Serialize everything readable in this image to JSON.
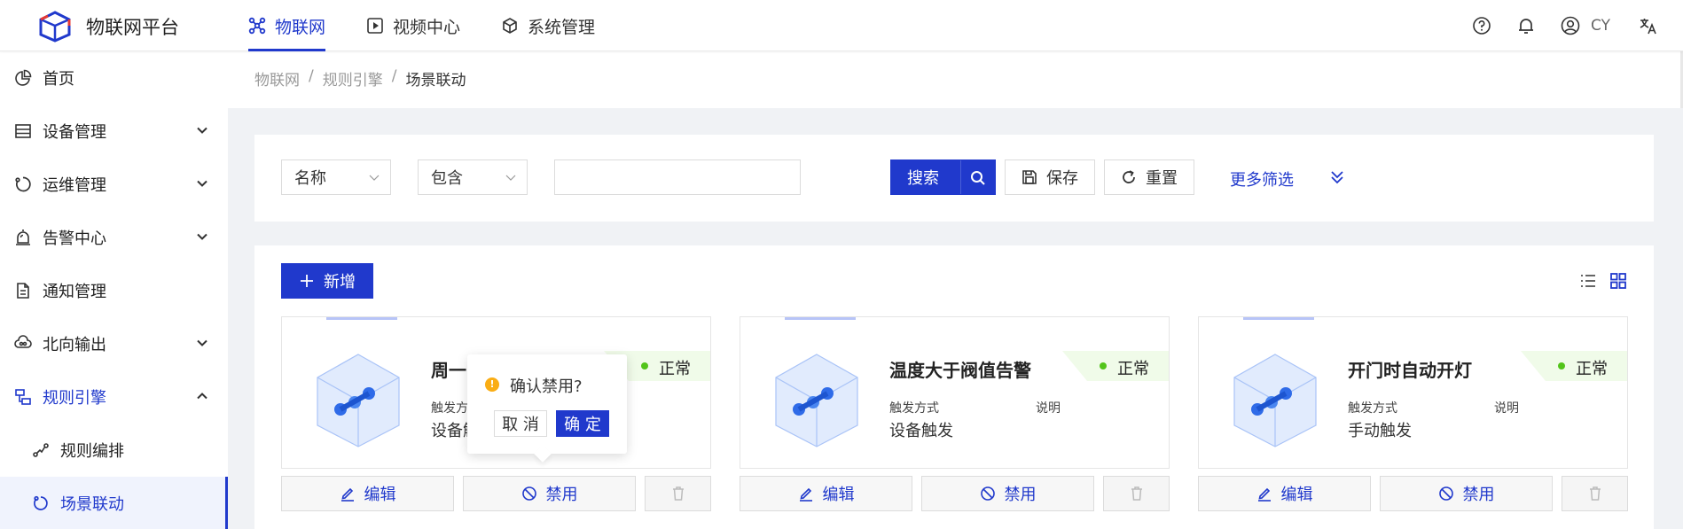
{
  "app": {
    "title": "物联网平台"
  },
  "topnav": [
    {
      "label": "物联网",
      "icon": "iot-icon",
      "active": true
    },
    {
      "label": "视频中心",
      "icon": "video-icon"
    },
    {
      "label": "系统管理",
      "icon": "system-icon"
    }
  ],
  "topright": {
    "user": "CY",
    "icons": [
      "help-icon",
      "bell-icon",
      "user-icon",
      "translate-icon"
    ]
  },
  "sidebar": {
    "items": [
      {
        "label": "首页",
        "icon": "pie-chart-icon"
      },
      {
        "label": "设备管理",
        "icon": "device-icon"
      },
      {
        "label": "运维管理",
        "icon": "ops-icon"
      },
      {
        "label": "告警中心",
        "icon": "alarm-icon"
      },
      {
        "label": "通知管理",
        "icon": "notice-icon"
      },
      {
        "label": "北向输出",
        "icon": "export-icon"
      },
      {
        "label": "规则引擎",
        "icon": "rule-icon"
      }
    ],
    "sub_items": [
      {
        "label": "规则编排",
        "icon": "flow-icon"
      },
      {
        "label": "场景联动",
        "icon": "scene-icon"
      }
    ]
  },
  "breadcrumb": {
    "items": [
      "物联网",
      "规则引擎",
      "场景联动"
    ],
    "sep": "/"
  },
  "search": {
    "field_select": "名称",
    "op_select": "包含",
    "value": "",
    "search_label": "搜索",
    "save_label": "保存",
    "reset_label": "重置",
    "more_label": "更多筛选"
  },
  "list": {
    "add_label": "新增",
    "trigger_label": "触发方式",
    "desc_label": "说明",
    "edit_label": "编辑",
    "disable_label": "禁用",
    "cards": [
      {
        "title": "周一",
        "status": "正常",
        "trigger": "设备触",
        "desc": ""
      },
      {
        "title": "温度大于阀值告警",
        "status": "正常",
        "trigger": "设备触发",
        "desc": ""
      },
      {
        "title": "开门时自动开灯",
        "status": "正常",
        "trigger": "手动触发",
        "desc": ""
      }
    ]
  },
  "popconfirm": {
    "message": "确认禁用?",
    "cancel": "取 消",
    "ok": "确 定"
  },
  "colors": {
    "primary": "#2039cc",
    "success": "#52c41a",
    "warning": "#faad14"
  }
}
